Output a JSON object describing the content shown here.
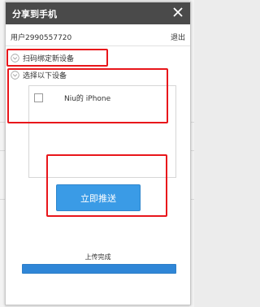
{
  "dialog": {
    "title": "分享到手机",
    "user_label": "用户2990557720",
    "logout_label": "退出"
  },
  "sections": {
    "scan_bind": {
      "label": "扫码绑定新设备",
      "icon": "chevron-down-icon"
    },
    "select_device": {
      "label": "选择以下设备",
      "icon": "chevron-down-icon"
    }
  },
  "devices": [
    {
      "name": "Niu的 iPhone",
      "checked": false
    }
  ],
  "push_button": {
    "label": "立即推送"
  },
  "upload": {
    "status": "上传完成",
    "progress": 1.0
  },
  "colors": {
    "titlebar": "#4a4a4a",
    "button": "#3a9be6",
    "progress": "#2f86d7",
    "annotation_red": "#e8161b"
  }
}
